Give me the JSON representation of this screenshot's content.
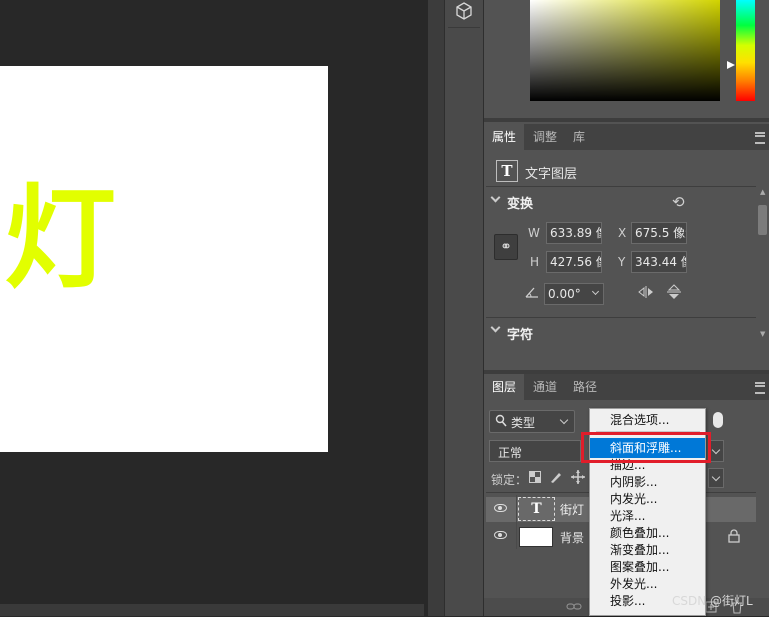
{
  "canvas": {
    "document_text": "灯",
    "text_color": "#e2ff00"
  },
  "properties_panel": {
    "tabs": [
      "属性",
      "调整",
      "库"
    ],
    "active_tab": 0,
    "layer_type": "文字图层",
    "transform_title": "变换",
    "w_label": "W",
    "w_value": "633.89 像素",
    "x_label": "X",
    "x_value": "675.5 像素",
    "h_label": "H",
    "h_value": "427.56 像素",
    "y_label": "Y",
    "y_value": "343.44 像素",
    "angle_value": "0.00°",
    "character_title": "字符"
  },
  "layers_panel": {
    "tabs": [
      "图层",
      "通道",
      "路径"
    ],
    "active_tab": 0,
    "filter_kind": "类型",
    "blend_mode": "正常",
    "lock_label": "锁定：",
    "layers": [
      {
        "name": "街灯",
        "kind": "text",
        "selected": true
      },
      {
        "name": "背景",
        "kind": "background",
        "locked": true
      }
    ]
  },
  "context_menu": {
    "items": [
      "混合选项...",
      "斜面和浮雕...",
      "描边...",
      "内阴影...",
      "内发光...",
      "光泽...",
      "颜色叠加...",
      "渐变叠加...",
      "图案叠加...",
      "外发光...",
      "投影..."
    ],
    "highlighted_index": 1
  },
  "watermark": "CSDN @街灯L",
  "colors": {
    "highlight": "#0078d7",
    "annotation_box": "#e11d2a",
    "panel_bg": "#535353"
  }
}
